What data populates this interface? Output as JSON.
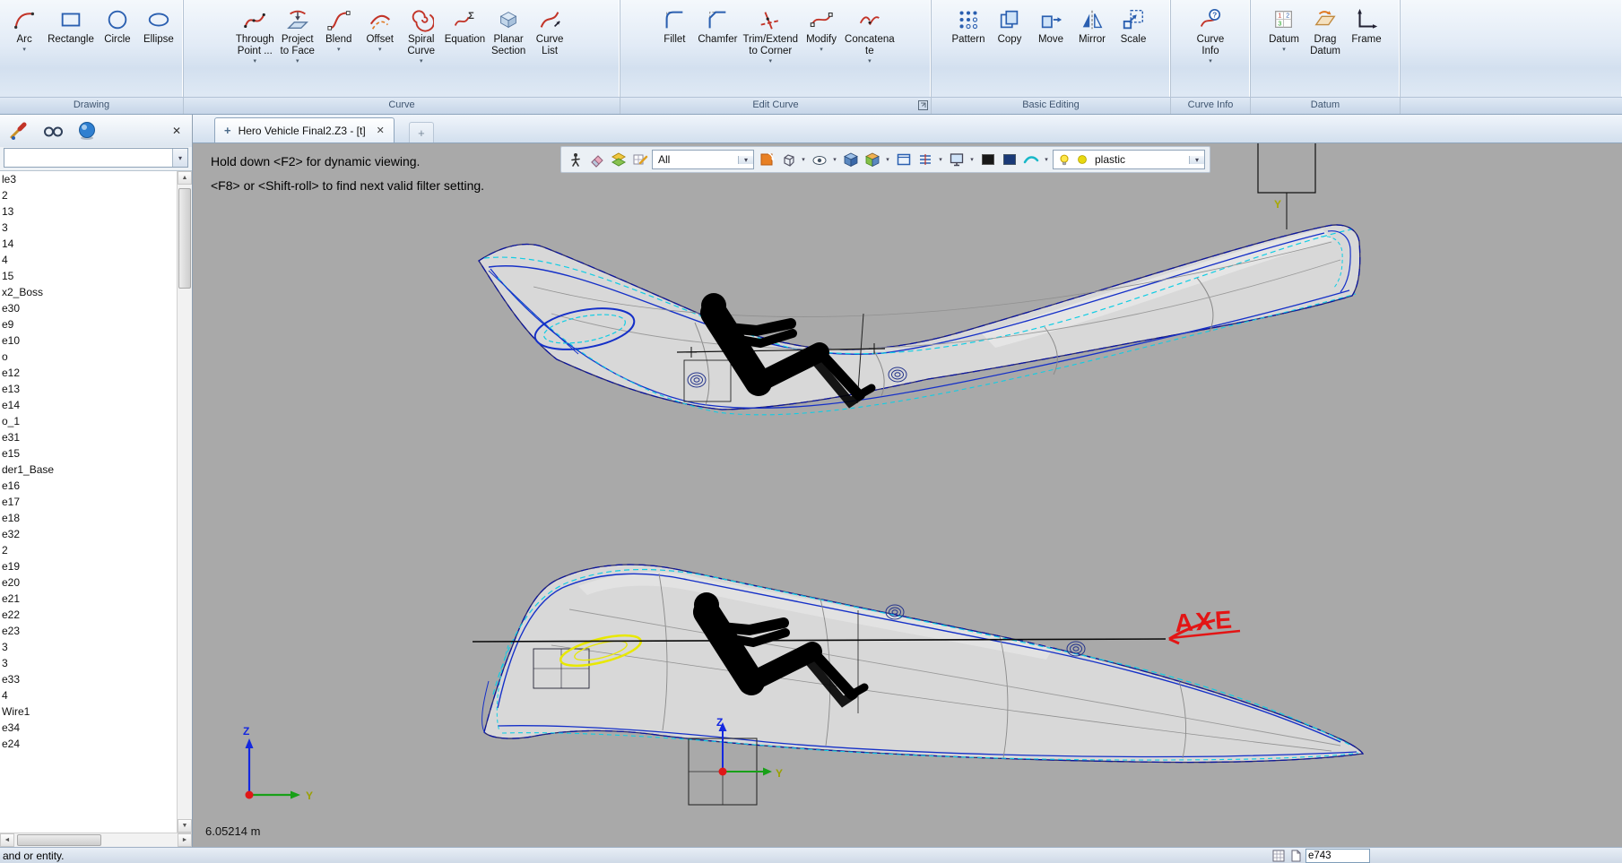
{
  "icons": {
    "plus": "+",
    "close": "✕",
    "chevron": "▾",
    "scroll_up": "▲",
    "scroll_down": "▼",
    "scroll_left": "◄",
    "scroll_right": "►"
  },
  "ribbon": {
    "groups": [
      {
        "label": "Drawing",
        "buttons": [
          {
            "label": "Arc",
            "chevron": true
          },
          {
            "label": "Rectangle"
          },
          {
            "label": "Circle"
          },
          {
            "label": "Ellipse"
          }
        ]
      },
      {
        "label": "Curve",
        "buttons": [
          {
            "label": "Through\nPoint ...",
            "chevron": true
          },
          {
            "label": "Project\nto Face",
            "chevron": true
          },
          {
            "label": "Blend",
            "chevron": true
          },
          {
            "label": "Offset",
            "chevron": true
          },
          {
            "label": "Spiral\nCurve",
            "chevron": true
          },
          {
            "label": "Equation"
          },
          {
            "label": "Planar\nSection"
          },
          {
            "label": "Curve\nList"
          }
        ]
      },
      {
        "label": "Edit Curve",
        "buttons": [
          {
            "label": "Fillet"
          },
          {
            "label": "Chamfer"
          },
          {
            "label": "Trim/Extend\nto Corner",
            "chevron": true
          },
          {
            "label": "Modify",
            "chevron": true
          },
          {
            "label": "Concatena\nte",
            "chevron": true
          }
        ]
      },
      {
        "label": "Basic Editing",
        "buttons": [
          {
            "label": "Pattern"
          },
          {
            "label": "Copy"
          },
          {
            "label": "Move"
          },
          {
            "label": "Mirror"
          },
          {
            "label": "Scale"
          }
        ]
      },
      {
        "label": "Curve Info",
        "buttons": [
          {
            "label": "Curve\nInfo",
            "chevron": true
          }
        ]
      },
      {
        "label": "Datum",
        "buttons": [
          {
            "label": "Datum",
            "chevron": true
          },
          {
            "label": "Drag\nDatum"
          },
          {
            "label": "Frame"
          }
        ]
      }
    ]
  },
  "tabbar": {
    "title": "Hero Vehicle Final2.Z3 - [t]"
  },
  "sidebar": {
    "items": [
      "le3",
      "2",
      "13",
      "3",
      "14",
      "4",
      "15",
      "x2_Boss",
      "e30",
      "e9",
      "e10",
      "o",
      "e12",
      "e13",
      "e14",
      "o_1",
      "e31",
      "e15",
      "der1_Base",
      "e16",
      "e17",
      "e18",
      "e32",
      "2",
      "e19",
      "e20",
      "e21",
      "e22",
      "e23",
      "3",
      "3",
      "e33",
      "4",
      "Wire1",
      "e34",
      "e24"
    ]
  },
  "viewport_toolbar": {
    "filter": "All",
    "material": "plastic"
  },
  "canvas": {
    "hint_line1": "Hold down <F2> for dynamic viewing.",
    "hint_line2": "<F8> or <Shift-roll> to find next valid filter setting.",
    "measurement": "6.05214 m",
    "annotation": "AXE",
    "axes": {
      "z": "Z",
      "y": "Y"
    }
  },
  "statusbar": {
    "prompt": "and or entity.",
    "command_value": "e743"
  }
}
